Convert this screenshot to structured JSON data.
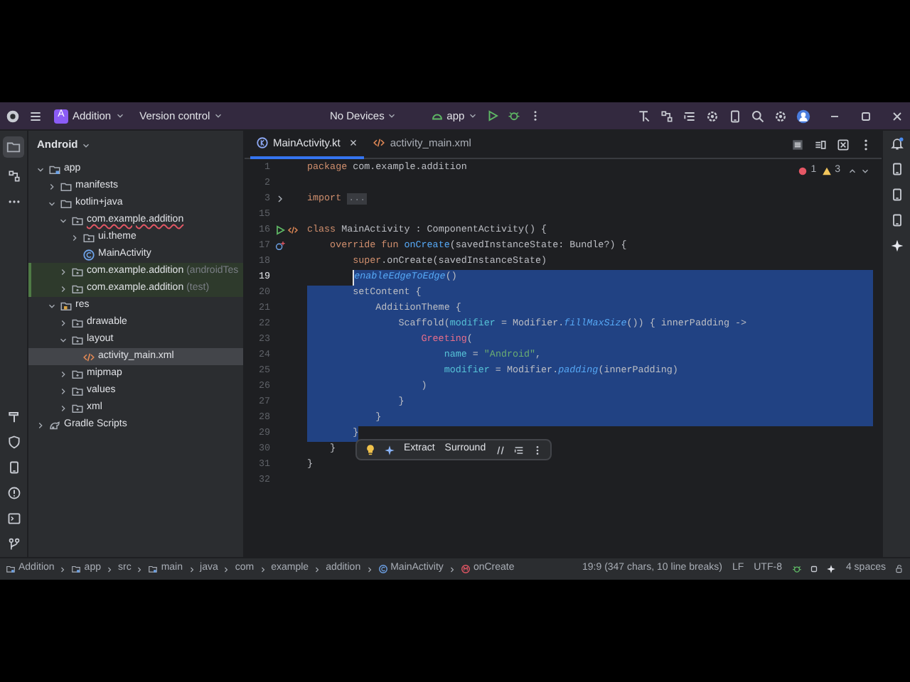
{
  "title_bar": {
    "project_badge": "A",
    "project": "Addition",
    "vcs": "Version control",
    "device": "No Devices",
    "run_config": "app"
  },
  "project_panel": {
    "view": "Android",
    "tree": [
      {
        "label": "app",
        "kind": "module",
        "expanded": true,
        "selected": false,
        "tinted": false,
        "error": false,
        "children": [
          {
            "label": "manifests",
            "kind": "folder",
            "expanded": false,
            "selected": false,
            "tinted": false,
            "error": false
          },
          {
            "label": "kotlin+java",
            "kind": "folder",
            "expanded": true,
            "selected": false,
            "tinted": false,
            "error": false,
            "children": [
              {
                "label": "com.example.addition",
                "kind": "package",
                "expanded": true,
                "selected": false,
                "tinted": false,
                "error": true,
                "children": [
                  {
                    "label": "ui.theme",
                    "kind": "package",
                    "expanded": false,
                    "selected": false,
                    "tinted": false,
                    "error": false
                  },
                  {
                    "label": "MainActivity",
                    "kind": "class",
                    "selected": false,
                    "tinted": false,
                    "error": false
                  }
                ]
              },
              {
                "label": "com.example.addition",
                "suffix": "(androidTes",
                "kind": "package",
                "expanded": false,
                "selected": false,
                "tinted": true,
                "error": false
              },
              {
                "label": "com.example.addition",
                "suffix": "(test)",
                "kind": "package",
                "expanded": false,
                "selected": false,
                "tinted": true,
                "error": false
              }
            ]
          },
          {
            "label": "res",
            "kind": "resfolder",
            "expanded": true,
            "selected": false,
            "tinted": false,
            "error": false,
            "children": [
              {
                "label": "drawable",
                "kind": "package",
                "expanded": false,
                "selected": false,
                "tinted": false,
                "error": false
              },
              {
                "label": "layout",
                "kind": "package",
                "expanded": true,
                "selected": false,
                "tinted": false,
                "error": false,
                "children": [
                  {
                    "label": "activity_main.xml",
                    "kind": "xml",
                    "selected": true,
                    "tinted": false,
                    "error": false
                  }
                ]
              },
              {
                "label": "mipmap",
                "kind": "package",
                "expanded": false,
                "selected": false,
                "tinted": false,
                "error": false
              },
              {
                "label": "values",
                "kind": "package",
                "expanded": false,
                "selected": false,
                "tinted": false,
                "error": false
              },
              {
                "label": "xml",
                "kind": "package",
                "expanded": false,
                "selected": false,
                "tinted": false,
                "error": false
              }
            ]
          }
        ]
      },
      {
        "label": "Gradle Scripts",
        "kind": "gradle",
        "expanded": false,
        "selected": false,
        "tinted": false,
        "error": false
      }
    ]
  },
  "tabs": [
    {
      "label": "MainActivity.kt",
      "kind": "kotlin",
      "selected": true
    },
    {
      "label": "activity_main.xml",
      "kind": "xml",
      "selected": false
    }
  ],
  "inspections": {
    "errors": "1",
    "warnings": "3"
  },
  "code": [
    {
      "number": "1",
      "current": false,
      "selected": false,
      "tokens": [
        {
          "text": "package ",
          "kind": "kw"
        },
        {
          "text": "com.example.addition",
          "kind": "plain"
        }
      ]
    },
    {
      "number": "2",
      "current": false,
      "selected": false
    },
    {
      "number": "3",
      "current": false,
      "selected": false,
      "gutter": [
        {
          "kind": "fold"
        }
      ],
      "tokens": [
        {
          "text": "import ",
          "kind": "kw"
        },
        {
          "text": "...",
          "kind": "fold"
        }
      ]
    },
    {
      "number": "15",
      "current": false,
      "selected": false
    },
    {
      "number": "16",
      "current": false,
      "selected": false,
      "gutter": [
        {
          "kind": "run"
        },
        {
          "kind": "layout"
        }
      ],
      "tokens": [
        {
          "text": "class ",
          "kind": "kw"
        },
        {
          "text": "MainActivity : ComponentActivity() {",
          "kind": "plain"
        }
      ]
    },
    {
      "number": "17",
      "current": false,
      "selected": false,
      "gutter": [
        {
          "kind": "override"
        }
      ],
      "tokens": [
        {
          "text": "    override fun ",
          "kind": "kw"
        },
        {
          "text": "onCreate",
          "kind": "fn"
        },
        {
          "text": "(savedInstanceState: Bundle?) {",
          "kind": "plain"
        }
      ]
    },
    {
      "number": "18",
      "current": false,
      "selected": false,
      "tokens": [
        {
          "text": "        super",
          "kind": "kw"
        },
        {
          "text": ".onCreate(savedInstanceState)",
          "kind": "plain"
        }
      ]
    },
    {
      "number": "19",
      "current": true,
      "selected": true,
      "tokens": [
        {
          "text": "        enableEdgeToEdge",
          "kind": "ext"
        },
        {
          "text": "()",
          "kind": "plain"
        }
      ]
    },
    {
      "number": "20",
      "current": false,
      "selected": true,
      "tokens": [
        {
          "text": "        setContent {",
          "kind": "plain"
        }
      ]
    },
    {
      "number": "21",
      "current": false,
      "selected": true,
      "tokens": [
        {
          "text": "            AdditionTheme {",
          "kind": "plain"
        }
      ]
    },
    {
      "number": "22",
      "current": false,
      "selected": true,
      "tokens": [
        {
          "text": "                Scaffold(",
          "kind": "plain"
        },
        {
          "text": "modifier",
          "kind": "param"
        },
        {
          "text": " = Modifier.",
          "kind": "plain"
        },
        {
          "text": "fillMaxSize",
          "kind": "ext"
        },
        {
          "text": "()) { innerPadding ->",
          "kind": "plain"
        }
      ]
    },
    {
      "number": "23",
      "current": false,
      "selected": true,
      "tokens": [
        {
          "text": "                    Greeting",
          "kind": "composable"
        },
        {
          "text": "(",
          "kind": "plain"
        }
      ]
    },
    {
      "number": "24",
      "current": false,
      "selected": true,
      "tokens": [
        {
          "text": "                        name",
          "kind": "param"
        },
        {
          "text": " = ",
          "kind": "plain"
        },
        {
          "text": "\"Android\"",
          "kind": "str"
        },
        {
          "text": ",",
          "kind": "plain"
        }
      ]
    },
    {
      "number": "25",
      "current": false,
      "selected": true,
      "tokens": [
        {
          "text": "                        modifier",
          "kind": "param"
        },
        {
          "text": " = Modifier.",
          "kind": "plain"
        },
        {
          "text": "padding",
          "kind": "ext"
        },
        {
          "text": "(innerPadding)",
          "kind": "plain"
        }
      ]
    },
    {
      "number": "26",
      "current": false,
      "selected": true,
      "tokens": [
        {
          "text": "                    )",
          "kind": "plain"
        }
      ]
    },
    {
      "number": "27",
      "current": false,
      "selected": true,
      "tokens": [
        {
          "text": "                }",
          "kind": "plain"
        }
      ]
    },
    {
      "number": "28",
      "current": false,
      "selected": true,
      "tokens": [
        {
          "text": "            }",
          "kind": "plain"
        }
      ]
    },
    {
      "number": "29",
      "current": false,
      "selected": true,
      "tokens": [
        {
          "text": "        }",
          "kind": "plain"
        }
      ]
    },
    {
      "number": "30",
      "current": false,
      "selected": false,
      "tokens": [
        {
          "text": "    }",
          "kind": "plain"
        }
      ]
    },
    {
      "number": "31",
      "current": false,
      "selected": false,
      "tokens": [
        {
          "text": "}",
          "kind": "plain"
        }
      ]
    },
    {
      "number": "32",
      "current": false,
      "selected": false
    }
  ],
  "floating_toolbar": {
    "actions": [
      "Extract",
      "Surround"
    ]
  },
  "status_bar": {
    "breadcrumbs": [
      {
        "text": "Addition",
        "kind": "module"
      },
      {
        "text": "app",
        "kind": "module"
      },
      {
        "text": "src",
        "kind": "plain"
      },
      {
        "text": "main",
        "kind": "module"
      },
      {
        "text": "java",
        "kind": "plain"
      },
      {
        "text": "com",
        "kind": "plain"
      },
      {
        "text": "example",
        "kind": "plain"
      },
      {
        "text": "addition",
        "kind": "plain"
      },
      {
        "text": "MainActivity",
        "kind": "class"
      },
      {
        "text": "onCreate",
        "kind": "method"
      }
    ],
    "position": "19:9 (347 chars, 10 line breaks)",
    "line_ending": "LF",
    "encoding": "UTF-8",
    "indent": "4 spaces"
  }
}
